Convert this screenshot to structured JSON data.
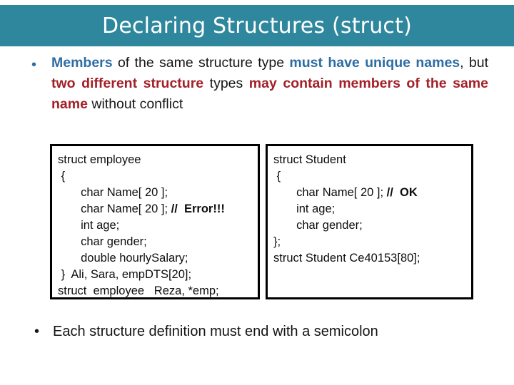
{
  "slide": {
    "title": "Declaring Structures (struct)",
    "banner_color": "#2F879D",
    "title_color": "#FFFFFF",
    "background_color": "#FFFFFF"
  },
  "intro_bullet": {
    "bullet_glyph": "•",
    "accent_blue": "#2E6DA4",
    "accent_red": "#A32028",
    "segments": [
      {
        "text": "Members",
        "style": "blue"
      },
      {
        "text": " of the same structure type ",
        "style": "plain"
      },
      {
        "text": "must have unique names",
        "style": "blue"
      },
      {
        "text": ", but ",
        "style": "plain"
      },
      {
        "text": "two different structure",
        "style": "red"
      },
      {
        "text": " types ",
        "style": "plain"
      },
      {
        "text": "may contain members of the same name",
        "style": "red"
      },
      {
        "text": " without conflict",
        "style": "plain"
      }
    ]
  },
  "code_box_left": {
    "lines": [
      {
        "code": "struct employee",
        "comment": ""
      },
      {
        "code": " {",
        "comment": ""
      },
      {
        "code": "       char Name[ 20 ];",
        "comment": ""
      },
      {
        "code": "       char Name[ 20 ]; ",
        "comment": "//  Error!!!"
      },
      {
        "code": "       int age;",
        "comment": ""
      },
      {
        "code": "       char gender;",
        "comment": ""
      },
      {
        "code": "       double hourlySalary;",
        "comment": ""
      },
      {
        "code": " }  Ali, Sara, empDTS[20];",
        "comment": ""
      },
      {
        "code": "struct  employee   Reza, *emp;",
        "comment": ""
      }
    ]
  },
  "code_box_right": {
    "lines": [
      {
        "code": "struct Student",
        "comment": ""
      },
      {
        "code": " {",
        "comment": ""
      },
      {
        "code": "       char Name[ 20 ]; ",
        "comment": "//  OK"
      },
      {
        "code": "       int age;",
        "comment": ""
      },
      {
        "code": "       char gender;",
        "comment": ""
      },
      {
        "code": "};",
        "comment": ""
      },
      {
        "code": "struct Student Ce40153[80];",
        "comment": ""
      },
      {
        "code": "",
        "comment": ""
      },
      {
        "code": "",
        "comment": ""
      }
    ]
  },
  "closing_bullet": {
    "bullet_glyph": "•",
    "text": "Each structure definition must end with a semicolon"
  }
}
